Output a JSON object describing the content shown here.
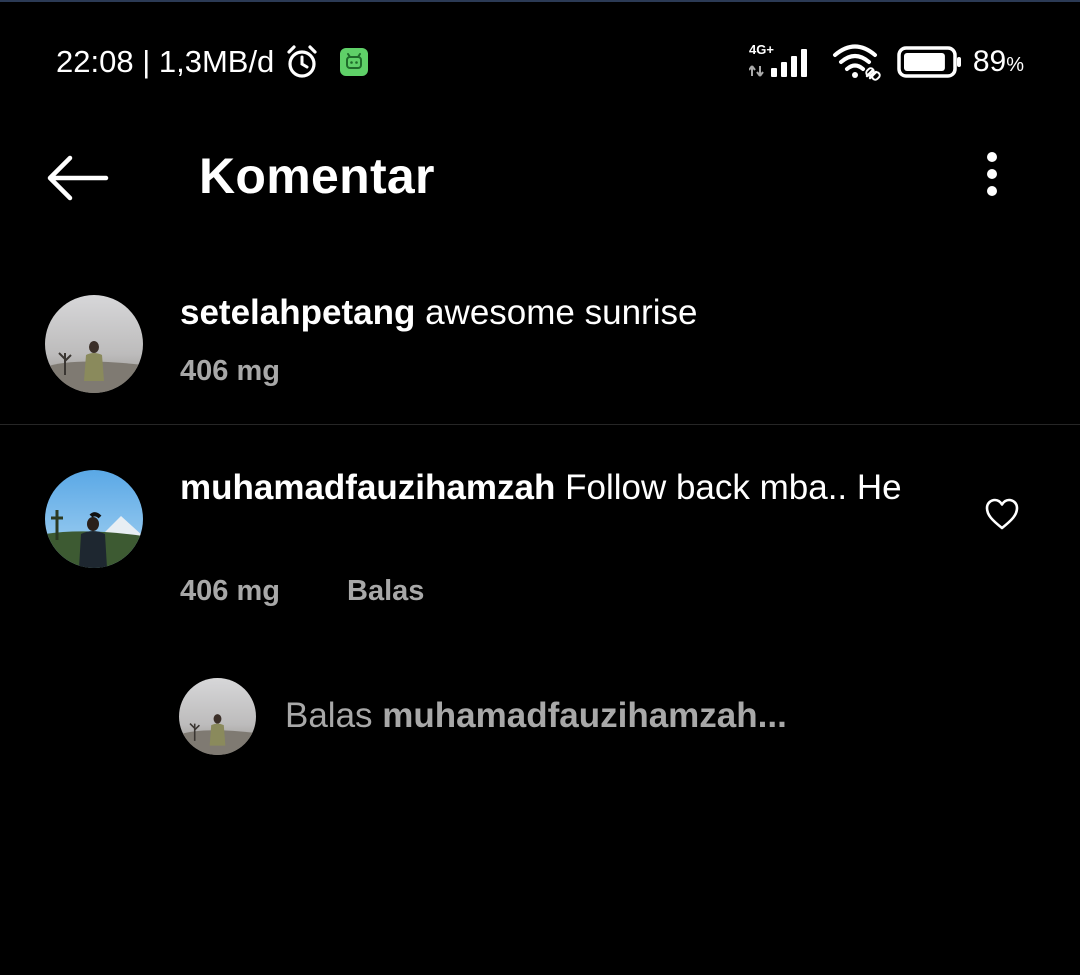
{
  "status_bar": {
    "time_speed": "22:08 | 1,3MB/d",
    "network_type": "4G+",
    "battery_percent": "89",
    "battery_unit": "%",
    "battery_level": 0.89,
    "icons": [
      "alarm-icon",
      "notification-app-icon",
      "cellular-signal-icon",
      "wifi-icon",
      "battery-icon"
    ]
  },
  "header": {
    "title": "Komentar",
    "icons": [
      "back-arrow-icon",
      "more-options-icon"
    ]
  },
  "caption": {
    "username": "setelahpetang",
    "text": "awesome sunrise",
    "time": "406 mg"
  },
  "comments": [
    {
      "username": "muhamadfauzihamzah",
      "text": "Follow back mba.. He",
      "time": "406 mg",
      "reply_label": "Balas"
    }
  ],
  "reply_composer": {
    "prefix": "Balas",
    "target": "muhamadfauzihamzah..."
  },
  "colors": {
    "background": "#000000",
    "text_primary": "#ffffff",
    "text_secondary": "#a8a8a8",
    "notification_icon": "#5fd068"
  }
}
